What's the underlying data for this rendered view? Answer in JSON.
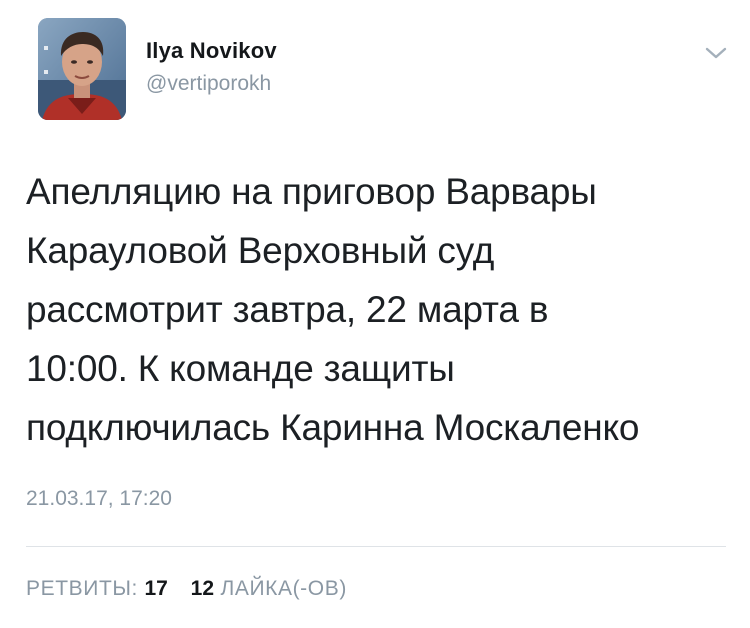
{
  "author": {
    "display_name": "Ilya Novikov",
    "handle": "@vertiporokh"
  },
  "tweet": {
    "lines": [
      "Апелляцию на приговор Варвары",
      "Карауловой Верховный суд",
      "рассмотрит завтра, 22 марта в",
      "10:00. К команде защиты",
      "подключилась Каринна Москаленко"
    ],
    "timestamp": "21.03.17, 17:20"
  },
  "stats": {
    "retweets_label": "РЕТВИТЫ:",
    "retweets_count": "17",
    "likes_count": "12",
    "likes_label": "ЛАЙКА(-ОВ)"
  },
  "icons": {
    "menu": "chevron-down-icon"
  },
  "colors": {
    "secondary_text": "#8a97a3",
    "primary_text": "#14171a",
    "divider": "#dfe3e7"
  }
}
